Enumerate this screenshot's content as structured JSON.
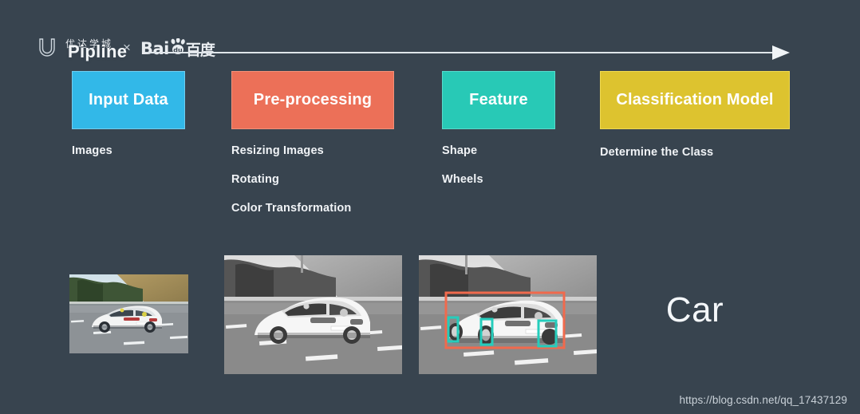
{
  "background_color": "#38444f",
  "branding": {
    "udacity_logo_icon": "udacity-u-icon",
    "udacity_cn_name": "优达学城",
    "cross_symbol": "×",
    "baidu_latin": "Bai",
    "baidu_paw_icon": "baidu-paw-icon",
    "baidu_du": "du",
    "baidu_cn_name": "百度",
    "overlay_title": "Pipline"
  },
  "arrow": {
    "icon": "right-arrow-icon",
    "color": "#dfe5ea"
  },
  "stages": [
    {
      "label": "Input Data",
      "color": "#32b8e8",
      "border_color": "#6fcdf0",
      "items": [
        "Images"
      ]
    },
    {
      "label": "Pre-processing",
      "color": "#ec7058",
      "border_color": "#f29078",
      "items": [
        "Resizing Images",
        "Rotating",
        "Color Transformation"
      ]
    },
    {
      "label": "Feature",
      "color": "#28c9b6",
      "border_color": "#56dbcb",
      "items": [
        "Shape",
        "Wheels"
      ]
    },
    {
      "label": "Classification Model",
      "color": "#ddc32f",
      "border_color": "#efd951",
      "items": [
        "Determine the Class"
      ]
    }
  ],
  "photos": [
    {
      "name": "input-photo-color",
      "description": "Color photo of white sedan driving on a highway",
      "mode": "color"
    },
    {
      "name": "preprocessed-photo-grayscale",
      "description": "Grayscale version of the white sedan photo",
      "mode": "grayscale"
    },
    {
      "name": "feature-photo-annotated",
      "description": "Grayscale sedan photo with detection boxes",
      "mode": "grayscale-annotated",
      "annotations": {
        "car_box_color": "#f06a4d",
        "feature_box_color": "#25cdbc",
        "feature_box_count": 3
      }
    }
  ],
  "result": {
    "label": "Car"
  },
  "watermark": {
    "text": "https://blog.csdn.net/qq_17437129"
  }
}
